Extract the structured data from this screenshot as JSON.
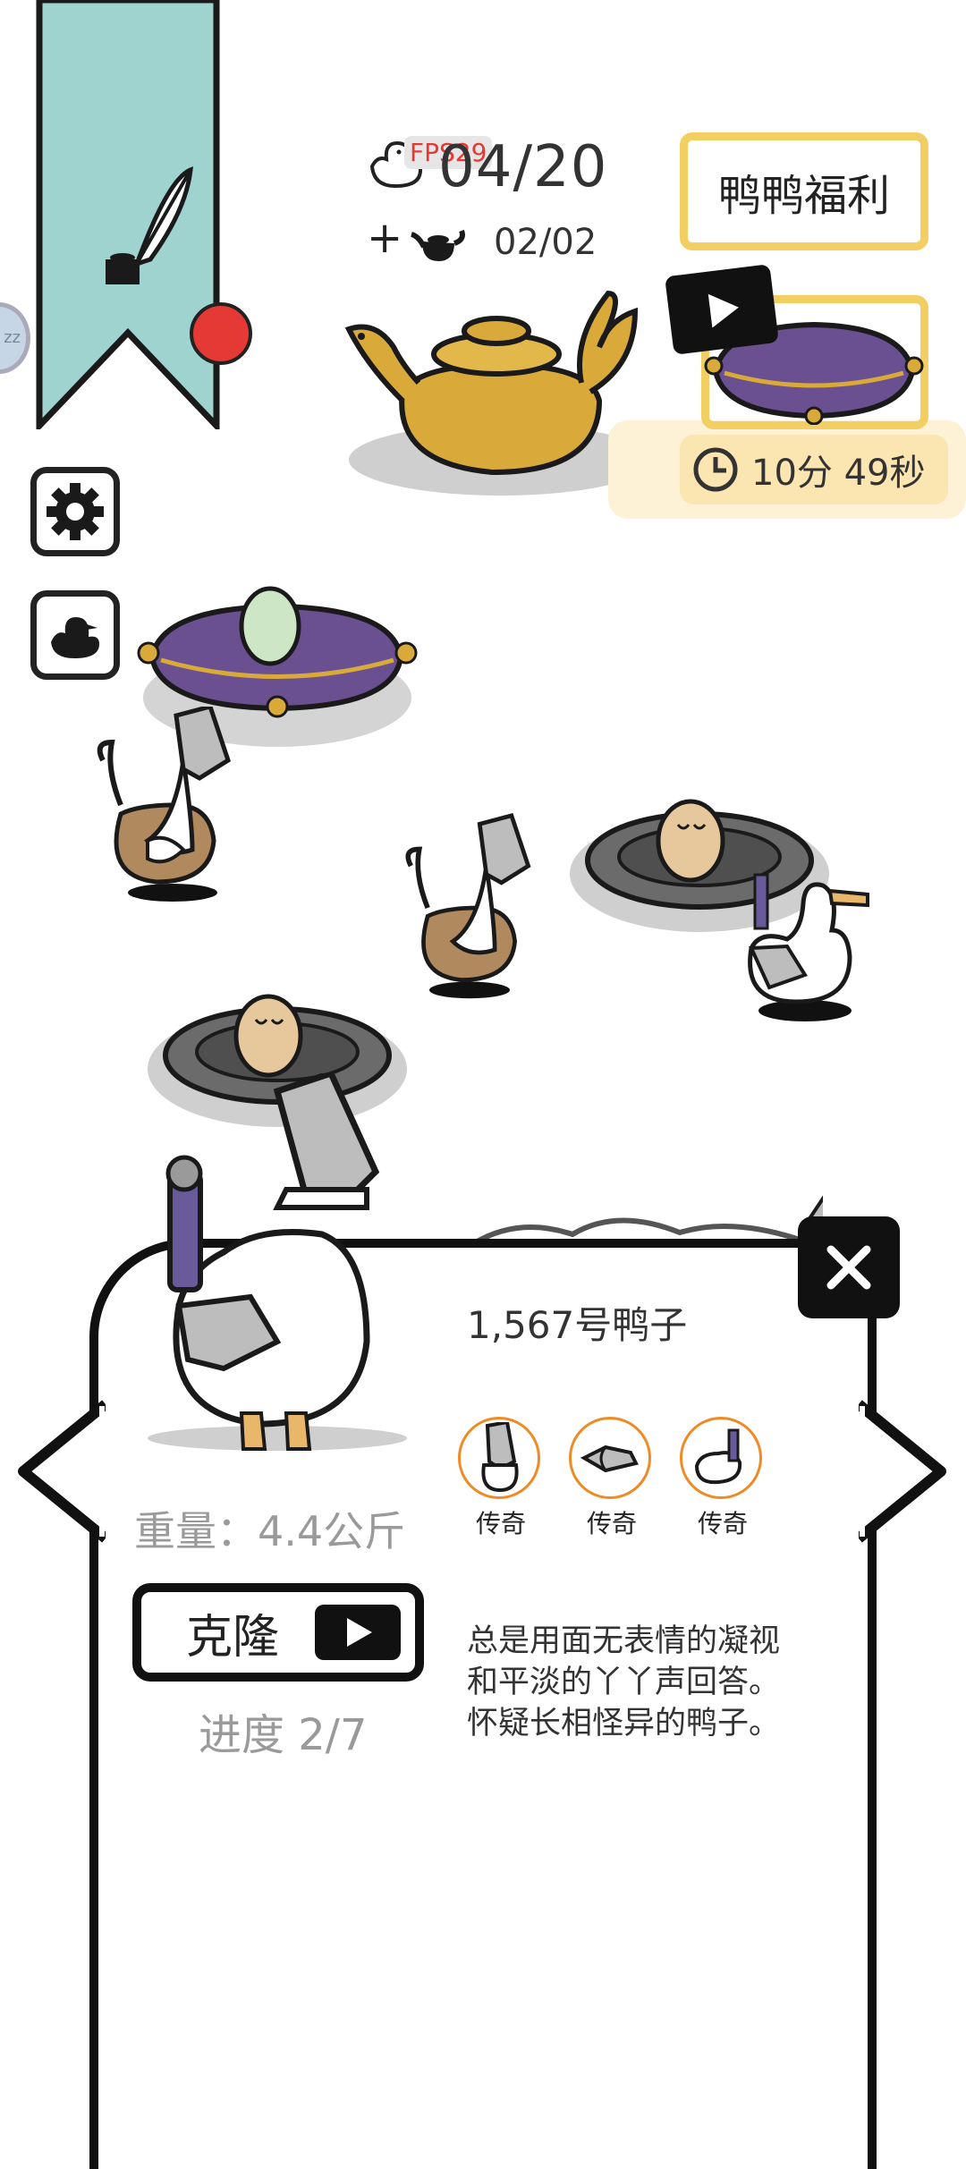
{
  "hud": {
    "fps": "FPS29",
    "duck_count": "04/20",
    "plus": "+",
    "teapot_count": "02/02"
  },
  "welfare": {
    "label": "鸭鸭福利",
    "timer": "10分 49秒"
  },
  "panel": {
    "duck_name": "1,567号鸭子",
    "traits": [
      {
        "icon": "sword-hat-icon",
        "label": "传奇"
      },
      {
        "icon": "sword-wing-icon",
        "label": "传奇"
      },
      {
        "icon": "sword-tail-icon",
        "label": "传奇"
      }
    ],
    "weight": "重量：4.4公斤",
    "clone_label": "克隆",
    "progress": "进度 2/7",
    "description": [
      "总是用面无表情的凝视",
      "和平淡的丫丫声回答。",
      "怀疑长相怪异的鸭子。"
    ]
  },
  "colors": {
    "gold": "#f3cf63",
    "banner_teal": "#9fd3cf",
    "cushion_purple": "#6a4f91",
    "trait_orange": "#f08a24"
  }
}
